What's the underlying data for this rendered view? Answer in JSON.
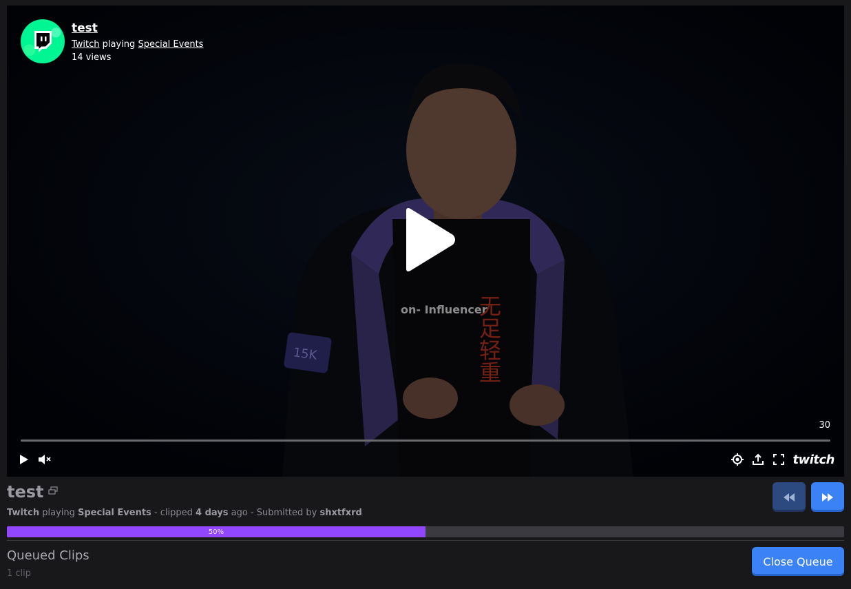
{
  "player": {
    "clip_title": "test",
    "broadcaster": "Twitch",
    "playing_word": "playing",
    "category": "Special Events",
    "views": "14 views",
    "timecode": "30",
    "brand": "twitch",
    "avatar_icon": "twitch-glitch-icon",
    "accent": "#00f593",
    "shirt_text": "on- Influencer",
    "shirt_chars": "无足轻重",
    "sleeve_badge": "15K"
  },
  "clip": {
    "title": "test",
    "broadcaster": "Twitch",
    "playing_word": "playing",
    "category": "Special Events",
    "clipped_prefix": "- clipped",
    "age": "4 days",
    "age_suffix": "ago - Submitted by",
    "submitter": "shxtfxrd"
  },
  "progress": {
    "percent": 50,
    "label": "50%",
    "color": "#9147ff"
  },
  "queue": {
    "title": "Queued Clips",
    "count": "1 clip",
    "close_label": "Close Queue"
  },
  "colors": {
    "primary_button": "#3b82f6",
    "primary_button_dim": "#2c4a80",
    "background": "#18181b"
  }
}
